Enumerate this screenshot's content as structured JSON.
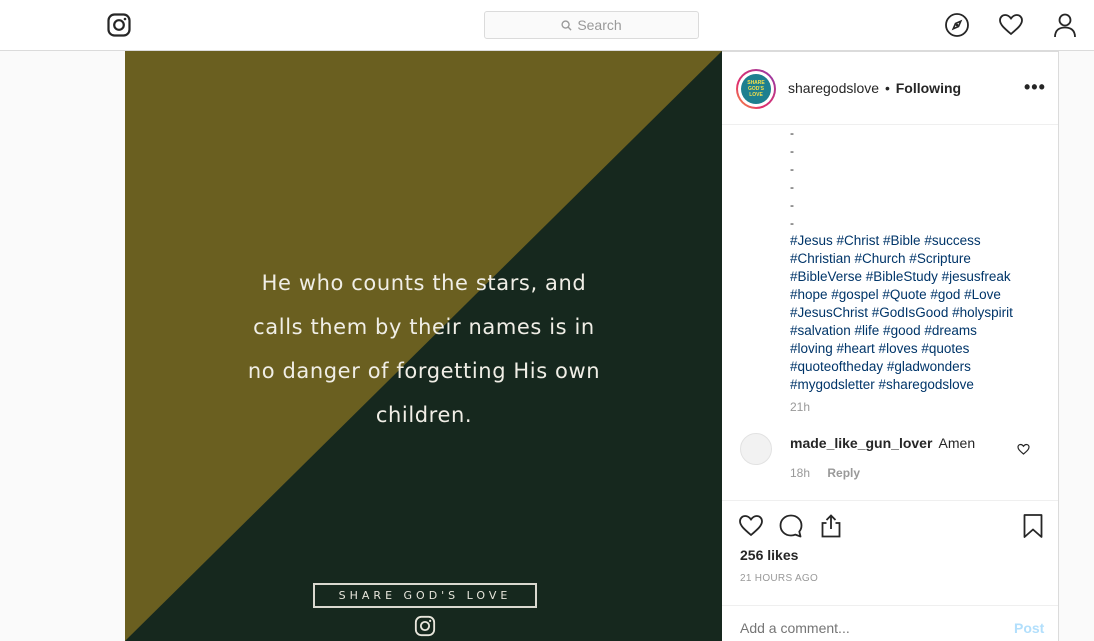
{
  "nav": {
    "search_placeholder": "Search",
    "icons": [
      "instagram-logo-icon",
      "search-icon",
      "compass-icon",
      "heart-icon",
      "user-icon"
    ]
  },
  "post_image": {
    "quote_lines": [
      "He who counts the stars, and",
      "calls them by their names is in",
      "no danger of forgetting His own",
      "children."
    ],
    "brand": "SHARE GOD'S LOVE",
    "colors": {
      "olive": "#6a5f20",
      "dark_green": "#16281e",
      "text": "#f0eee6"
    }
  },
  "header": {
    "username": "sharegodslove",
    "separator": "•",
    "follow_status": "Following",
    "avatar_text": "SHARE GOD'S LOVE",
    "more": "•••"
  },
  "caption": {
    "dots": [
      "-",
      "-",
      "-",
      "-",
      "-",
      "-"
    ],
    "hashtag_lines": [
      "#Jesus #Christ #Bible #success",
      "#Christian #Church #Scripture",
      "#BibleVerse #BibleStudy #jesusfreak",
      "#hope #gospel #Quote #god #Love",
      "#JesusChrist #GodIsGood #holyspirit",
      "#salvation #life #good #dreams",
      "#loving #heart #loves #quotes",
      "#quoteoftheday #gladwonders",
      "#mygodsletter #sharegodslove"
    ],
    "time": "21h"
  },
  "comment": {
    "username": "made_like_gun_lover",
    "text": "Amen",
    "time": "18h",
    "reply_label": "Reply"
  },
  "actions": {
    "likes": "256 likes",
    "time_ago": "21 HOURS AGO",
    "add_comment_placeholder": "Add a comment...",
    "post_label": "Post"
  }
}
